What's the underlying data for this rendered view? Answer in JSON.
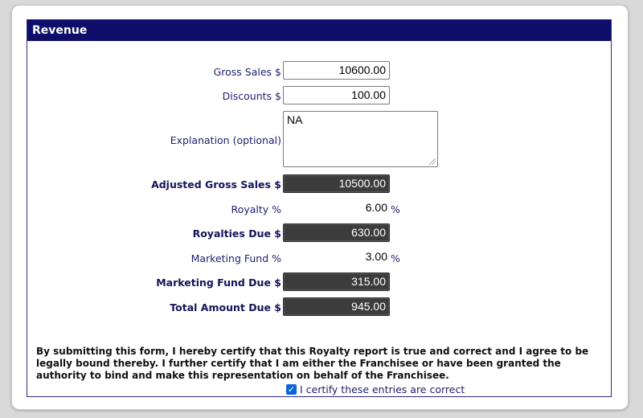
{
  "panel": {
    "title": "Revenue"
  },
  "form": {
    "gross_sales_label": "Gross Sales $",
    "gross_sales_value": "10600.00",
    "discounts_label": "Discounts $",
    "discounts_value": "100.00",
    "explanation_label": "Explanation (optional)",
    "explanation_value": "NA",
    "adjusted_label": "Adjusted Gross Sales $",
    "adjusted_value": "10500.00",
    "royalty_pct_label": "Royalty %",
    "royalty_pct_value": "6.00",
    "royalties_due_label": "Royalties Due $",
    "royalties_due_value": "630.00",
    "marketing_pct_label": "Marketing Fund %",
    "marketing_pct_value": "3.00",
    "marketing_due_label": "Marketing Fund Due $",
    "marketing_due_value": "315.00",
    "total_due_label": "Total Amount Due $",
    "total_due_value": "945.00",
    "percent_suffix": "%"
  },
  "certification": {
    "text": "By submitting this form, I hereby certify that this Royalty report is true and correct and I agree to be legally bound thereby. I further certify that I am either the Franchisee or have been granted the authority to bind and make this representation on behalf of the Franchisee.",
    "checkbox_label": "I certify these entries are correct",
    "checked": true
  },
  "colors": {
    "header_bg": "#0e0e6a",
    "label_text": "#1e1e6e",
    "readonly_bg": "#3c3c3c"
  }
}
